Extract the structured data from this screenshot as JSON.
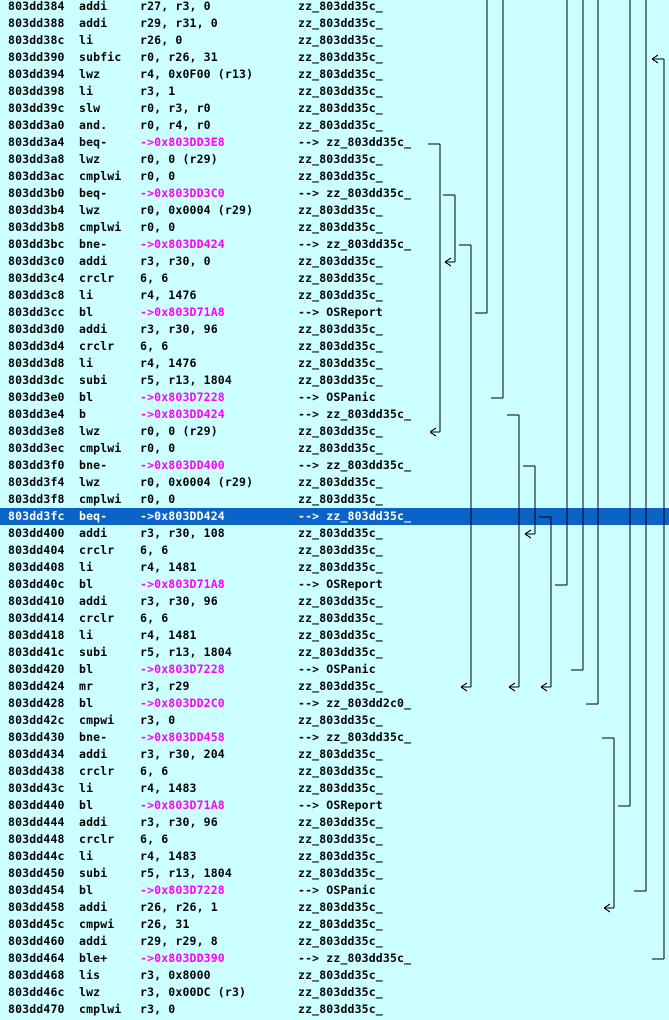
{
  "rows": [
    {
      "addr": "803dd384",
      "mn": "addi",
      "op": "r27, r3, 0",
      "tgt": "zz_803dd35c_"
    },
    {
      "addr": "803dd388",
      "mn": "addi",
      "op": "r29, r31, 0",
      "tgt": "zz_803dd35c_"
    },
    {
      "addr": "803dd38c",
      "mn": "li",
      "op": "r26, 0",
      "tgt": "zz_803dd35c_"
    },
    {
      "addr": "803dd390",
      "mn": "subfic",
      "op": "r0, r26, 31",
      "tgt": "zz_803dd35c_"
    },
    {
      "addr": "803dd394",
      "mn": "lwz",
      "op": "r4, 0x0F00 (r13)",
      "tgt": "zz_803dd35c_"
    },
    {
      "addr": "803dd398",
      "mn": "li",
      "op": "r3, 1",
      "tgt": "zz_803dd35c_"
    },
    {
      "addr": "803dd39c",
      "mn": "slw",
      "op": "r0, r3, r0",
      "tgt": "zz_803dd35c_"
    },
    {
      "addr": "803dd3a0",
      "mn": "and.",
      "op": "r0, r4, r0",
      "tgt": "zz_803dd35c_"
    },
    {
      "addr": "803dd3a4",
      "mn": "beq-",
      "op": "->0x803DD3E8",
      "tgt": "--> zz_803dd35c_",
      "branch": true
    },
    {
      "addr": "803dd3a8",
      "mn": "lwz",
      "op": "r0, 0 (r29)",
      "tgt": "zz_803dd35c_"
    },
    {
      "addr": "803dd3ac",
      "mn": "cmplwi",
      "op": "r0, 0",
      "tgt": "zz_803dd35c_"
    },
    {
      "addr": "803dd3b0",
      "mn": "beq-",
      "op": "->0x803DD3C0",
      "tgt": "--> zz_803dd35c_",
      "branch": true
    },
    {
      "addr": "803dd3b4",
      "mn": "lwz",
      "op": "r0, 0x0004 (r29)",
      "tgt": "zz_803dd35c_"
    },
    {
      "addr": "803dd3b8",
      "mn": "cmplwi",
      "op": "r0, 0",
      "tgt": "zz_803dd35c_"
    },
    {
      "addr": "803dd3bc",
      "mn": "bne-",
      "op": "->0x803DD424",
      "tgt": "--> zz_803dd35c_",
      "branch": true
    },
    {
      "addr": "803dd3c0",
      "mn": "addi",
      "op": "r3, r30, 0",
      "tgt": "zz_803dd35c_"
    },
    {
      "addr": "803dd3c4",
      "mn": "crclr",
      "op": "6, 6",
      "tgt": "zz_803dd35c_"
    },
    {
      "addr": "803dd3c8",
      "mn": "li",
      "op": "r4, 1476",
      "tgt": "zz_803dd35c_"
    },
    {
      "addr": "803dd3cc",
      "mn": "bl",
      "op": "->0x803D71A8",
      "tgt": "--> OSReport",
      "branch": true
    },
    {
      "addr": "803dd3d0",
      "mn": "addi",
      "op": "r3, r30, 96",
      "tgt": "zz_803dd35c_"
    },
    {
      "addr": "803dd3d4",
      "mn": "crclr",
      "op": "6, 6",
      "tgt": "zz_803dd35c_"
    },
    {
      "addr": "803dd3d8",
      "mn": "li",
      "op": "r4, 1476",
      "tgt": "zz_803dd35c_"
    },
    {
      "addr": "803dd3dc",
      "mn": "subi",
      "op": "r5, r13, 1804",
      "tgt": "zz_803dd35c_"
    },
    {
      "addr": "803dd3e0",
      "mn": "bl",
      "op": "->0x803D7228",
      "tgt": "--> OSPanic",
      "branch": true
    },
    {
      "addr": "803dd3e4",
      "mn": "b",
      "op": "->0x803DD424",
      "tgt": "--> zz_803dd35c_",
      "branch": true
    },
    {
      "addr": "803dd3e8",
      "mn": "lwz",
      "op": "r0, 0 (r29)",
      "tgt": "zz_803dd35c_"
    },
    {
      "addr": "803dd3ec",
      "mn": "cmplwi",
      "op": "r0, 0",
      "tgt": "zz_803dd35c_"
    },
    {
      "addr": "803dd3f0",
      "mn": "bne-",
      "op": "->0x803DD400",
      "tgt": "--> zz_803dd35c_",
      "branch": true
    },
    {
      "addr": "803dd3f4",
      "mn": "lwz",
      "op": "r0, 0x0004 (r29)",
      "tgt": "zz_803dd35c_"
    },
    {
      "addr": "803dd3f8",
      "mn": "cmplwi",
      "op": "r0, 0",
      "tgt": "zz_803dd35c_"
    },
    {
      "addr": "803dd3fc",
      "mn": "beq-",
      "op": "->0x803DD424",
      "tgt": "--> zz_803dd35c_",
      "branch": true,
      "selected": true
    },
    {
      "addr": "803dd400",
      "mn": "addi",
      "op": "r3, r30, 108",
      "tgt": "zz_803dd35c_"
    },
    {
      "addr": "803dd404",
      "mn": "crclr",
      "op": "6, 6",
      "tgt": "zz_803dd35c_"
    },
    {
      "addr": "803dd408",
      "mn": "li",
      "op": "r4, 1481",
      "tgt": "zz_803dd35c_"
    },
    {
      "addr": "803dd40c",
      "mn": "bl",
      "op": "->0x803D71A8",
      "tgt": "--> OSReport",
      "branch": true
    },
    {
      "addr": "803dd410",
      "mn": "addi",
      "op": "r3, r30, 96",
      "tgt": "zz_803dd35c_"
    },
    {
      "addr": "803dd414",
      "mn": "crclr",
      "op": "6, 6",
      "tgt": "zz_803dd35c_"
    },
    {
      "addr": "803dd418",
      "mn": "li",
      "op": "r4, 1481",
      "tgt": "zz_803dd35c_"
    },
    {
      "addr": "803dd41c",
      "mn": "subi",
      "op": "r5, r13, 1804",
      "tgt": "zz_803dd35c_"
    },
    {
      "addr": "803dd420",
      "mn": "bl",
      "op": "->0x803D7228",
      "tgt": "--> OSPanic",
      "branch": true
    },
    {
      "addr": "803dd424",
      "mn": "mr",
      "op": "r3, r29",
      "tgt": "zz_803dd35c_"
    },
    {
      "addr": "803dd428",
      "mn": "bl",
      "op": "->0x803DD2C0",
      "tgt": "--> zz_803dd2c0_",
      "branch": true
    },
    {
      "addr": "803dd42c",
      "mn": "cmpwi",
      "op": "r3, 0",
      "tgt": "zz_803dd35c_"
    },
    {
      "addr": "803dd430",
      "mn": "bne-",
      "op": "->0x803DD458",
      "tgt": "--> zz_803dd35c_",
      "branch": true
    },
    {
      "addr": "803dd434",
      "mn": "addi",
      "op": "r3, r30, 204",
      "tgt": "zz_803dd35c_"
    },
    {
      "addr": "803dd438",
      "mn": "crclr",
      "op": "6, 6",
      "tgt": "zz_803dd35c_"
    },
    {
      "addr": "803dd43c",
      "mn": "li",
      "op": "r4, 1483",
      "tgt": "zz_803dd35c_"
    },
    {
      "addr": "803dd440",
      "mn": "bl",
      "op": "->0x803D71A8",
      "tgt": "--> OSReport",
      "branch": true
    },
    {
      "addr": "803dd444",
      "mn": "addi",
      "op": "r3, r30, 96",
      "tgt": "zz_803dd35c_"
    },
    {
      "addr": "803dd448",
      "mn": "crclr",
      "op": "6, 6",
      "tgt": "zz_803dd35c_"
    },
    {
      "addr": "803dd44c",
      "mn": "li",
      "op": "r4, 1483",
      "tgt": "zz_803dd35c_"
    },
    {
      "addr": "803dd450",
      "mn": "subi",
      "op": "r5, r13, 1804",
      "tgt": "zz_803dd35c_"
    },
    {
      "addr": "803dd454",
      "mn": "bl",
      "op": "->0x803D7228",
      "tgt": "--> OSPanic",
      "branch": true
    },
    {
      "addr": "803dd458",
      "mn": "addi",
      "op": "r26, r26, 1",
      "tgt": "zz_803dd35c_"
    },
    {
      "addr": "803dd45c",
      "mn": "cmpwi",
      "op": "r26, 31",
      "tgt": "zz_803dd35c_"
    },
    {
      "addr": "803dd460",
      "mn": "addi",
      "op": "r29, r29, 8",
      "tgt": "zz_803dd35c_"
    },
    {
      "addr": "803dd464",
      "mn": "ble+",
      "op": "->0x803DD390",
      "tgt": "--> zz_803dd35c_",
      "branch": true
    },
    {
      "addr": "803dd468",
      "mn": "lis",
      "op": "r3, 0x8000",
      "tgt": "zz_803dd35c_"
    },
    {
      "addr": "803dd46c",
      "mn": "lwz",
      "op": "r3, 0x00DC (r3)",
      "tgt": "zz_803dd35c_"
    },
    {
      "addr": "803dd470",
      "mn": "cmplwi",
      "op": "r3, 0",
      "tgt": "zz_803dd35c_"
    }
  ],
  "colors": {
    "background": "#ccffff",
    "text": "#000000",
    "branch_operand": "#ff00ff",
    "selection": "#0a64c8",
    "selection_text": "#ffffff"
  }
}
